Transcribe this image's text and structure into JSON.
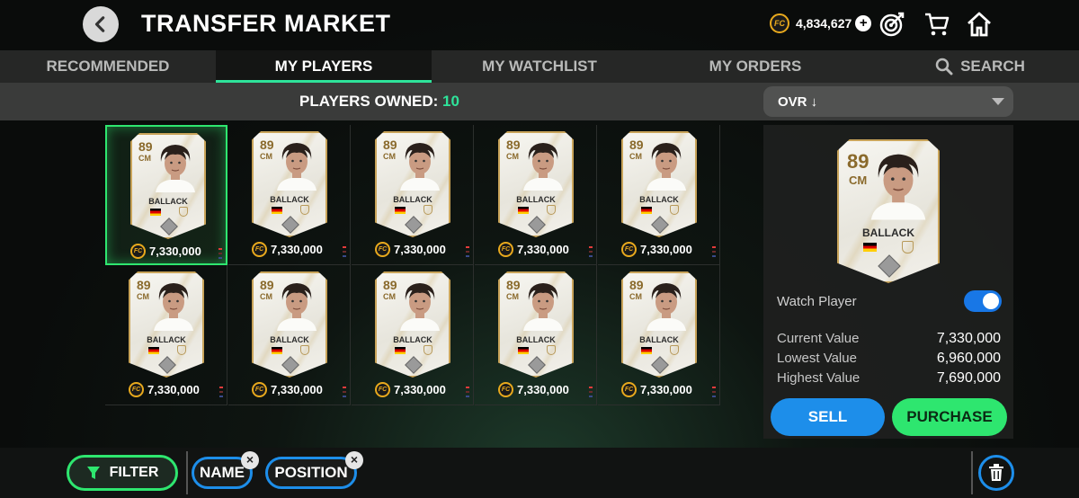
{
  "header": {
    "title": "TRANSFER MARKET",
    "coins": "4,834,627",
    "coin_symbol": "FC"
  },
  "tabs": [
    {
      "label": "RECOMMENDED",
      "active": false
    },
    {
      "label": "MY PLAYERS",
      "active": true
    },
    {
      "label": "MY WATCHLIST",
      "active": false
    },
    {
      "label": "MY ORDERS",
      "active": false
    },
    {
      "label": "SEARCH",
      "active": false
    }
  ],
  "owned": {
    "label": "PLAYERS OWNED:",
    "count": "10"
  },
  "sort": {
    "value": "OVR ↓"
  },
  "players": [
    {
      "ovr": "89",
      "pos": "CM",
      "name": "BALLACK",
      "price": "7,330,000",
      "selected": true
    },
    {
      "ovr": "89",
      "pos": "CM",
      "name": "BALLACK",
      "price": "7,330,000",
      "selected": false
    },
    {
      "ovr": "89",
      "pos": "CM",
      "name": "BALLACK",
      "price": "7,330,000",
      "selected": false
    },
    {
      "ovr": "89",
      "pos": "CM",
      "name": "BALLACK",
      "price": "7,330,000",
      "selected": false
    },
    {
      "ovr": "89",
      "pos": "CM",
      "name": "BALLACK",
      "price": "7,330,000",
      "selected": false
    },
    {
      "ovr": "89",
      "pos": "CM",
      "name": "BALLACK",
      "price": "7,330,000",
      "selected": false
    },
    {
      "ovr": "89",
      "pos": "CM",
      "name": "BALLACK",
      "price": "7,330,000",
      "selected": false
    },
    {
      "ovr": "89",
      "pos": "CM",
      "name": "BALLACK",
      "price": "7,330,000",
      "selected": false
    },
    {
      "ovr": "89",
      "pos": "CM",
      "name": "BALLACK",
      "price": "7,330,000",
      "selected": false
    },
    {
      "ovr": "89",
      "pos": "CM",
      "name": "BALLACK",
      "price": "7,330,000",
      "selected": false
    }
  ],
  "detail": {
    "ovr": "89",
    "pos": "CM",
    "name": "BALLACK",
    "watch_label": "Watch Player",
    "watch_on": true,
    "current_label": "Current Value",
    "current_value": "7,330,000",
    "lowest_label": "Lowest Value",
    "lowest_value": "6,960,000",
    "highest_label": "Highest Value",
    "highest_value": "7,690,000",
    "sell_label": "SELL",
    "purchase_label": "PURCHASE"
  },
  "bottom": {
    "filter_label": "FILTER",
    "chips": [
      "NAME",
      "POSITION"
    ]
  },
  "colors": {
    "accent_green": "#2ee66f",
    "teal": "#2ee39a",
    "accent_blue": "#1d8eea",
    "gold": "#e8a91d"
  }
}
